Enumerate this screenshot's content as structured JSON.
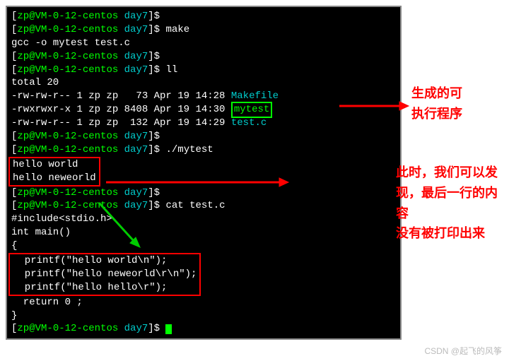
{
  "prompt": {
    "open": "[",
    "user": "zp",
    "at": "@",
    "host": "VM-0-12-centos",
    "dir": "day7",
    "close": "]",
    "symbol": "$"
  },
  "lines": {
    "l1_cmd": "",
    "l2_cmd": "make",
    "l3": "gcc -o mytest test.c",
    "l4_cmd": "",
    "l5_cmd": "ll",
    "l6": "total 20",
    "l7": "-rw-rw-r-- 1 zp zp   73 Apr 19 14:28 ",
    "l7_file": "Makefile",
    "l8": "-rwxrwxr-x 1 zp zp 8408 Apr 19 14:30 ",
    "l8_file": "mytest",
    "l9": "-rw-rw-r-- 1 zp zp  132 Apr 19 14:29 ",
    "l9_file": "test.c",
    "l10_cmd": "",
    "l11_cmd": "./mytest",
    "l12": "hello world",
    "l13": "hello neweorld",
    "l14_cmd": "",
    "l15_cmd": "cat test.c",
    "l16": "#include<stdio.h>",
    "l17": "int main()",
    "l18": "{",
    "l19": "  printf(\"hello world\\n\");",
    "l20": "  printf(\"hello neweorld\\r\\n\");",
    "l21": "  printf(\"hello hello\\r\");",
    "l22": "  return 0 ;",
    "l23": "}",
    "l24_cmd": ""
  },
  "annotations": {
    "a1_l1": "生成的可",
    "a1_l2": "执行程序",
    "a2_l1": "此时，我们可以发",
    "a2_l2": "现，最后一行的内容",
    "a2_l3": "没有被打印出来"
  },
  "watermark": "CSDN @起飞的风筝"
}
